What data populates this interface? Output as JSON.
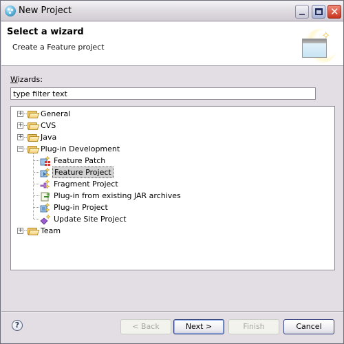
{
  "window": {
    "title": "New Project",
    "controls": {
      "minimize": "_",
      "maximize": "□",
      "close": "✕"
    }
  },
  "banner": {
    "title": "Select a wizard",
    "description": "Create a Feature project"
  },
  "filter": {
    "label_mnemonic": "W",
    "label_rest": "izards:",
    "placeholder": "type filter text",
    "value": "type filter text"
  },
  "tree": {
    "items": [
      {
        "label": "General",
        "type": "folder",
        "expanded": false,
        "level": 0
      },
      {
        "label": "CVS",
        "type": "folder",
        "expanded": false,
        "level": 0
      },
      {
        "label": "Java",
        "type": "folder",
        "expanded": false,
        "level": 0
      },
      {
        "label": "Plug-in Development",
        "type": "folder",
        "expanded": true,
        "level": 0
      },
      {
        "label": "Feature Patch",
        "type": "wizard",
        "icon": "feature-patch-icon",
        "level": 1
      },
      {
        "label": "Feature Project",
        "type": "wizard",
        "icon": "feature-project-icon",
        "level": 1,
        "selected": true
      },
      {
        "label": "Fragment Project",
        "type": "wizard",
        "icon": "fragment-project-icon",
        "level": 1
      },
      {
        "label": "Plug-in from existing JAR archives",
        "type": "wizard",
        "icon": "plugin-from-jar-icon",
        "level": 1
      },
      {
        "label": "Plug-in Project",
        "type": "wizard",
        "icon": "plugin-project-icon",
        "level": 1
      },
      {
        "label": "Update Site Project",
        "type": "wizard",
        "icon": "update-site-icon",
        "level": 1
      },
      {
        "label": "Team",
        "type": "folder",
        "expanded": false,
        "level": 0
      }
    ]
  },
  "buttons": {
    "help": "?",
    "back": "< Back",
    "next": "Next >",
    "finish": "Finish",
    "cancel": "Cancel",
    "back_enabled": false,
    "finish_enabled": false
  }
}
